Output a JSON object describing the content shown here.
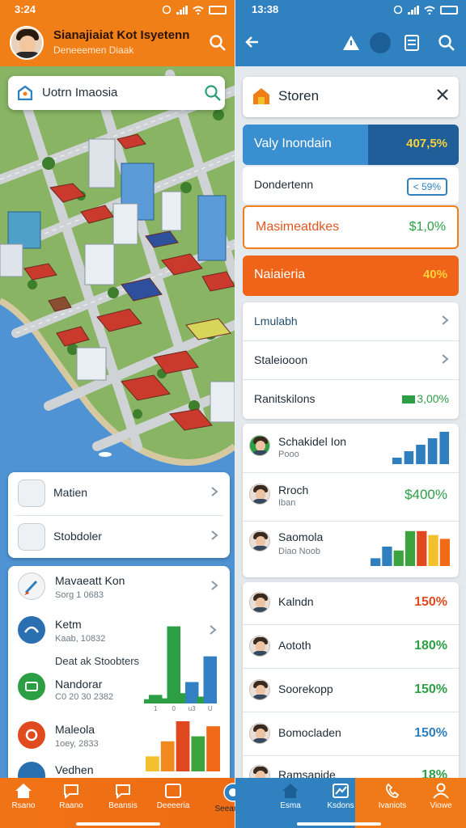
{
  "left": {
    "status": {
      "time": "3:24"
    },
    "header": {
      "title": "Sianajiaiat Kot Isyetenn",
      "subtitle": "Deneeemen Diaak"
    },
    "map_search": {
      "value": "Uotrn Imaosia"
    },
    "menu_top": [
      {
        "label": "Matien",
        "icon": "grid-icon"
      },
      {
        "label": "Stobdoler",
        "icon": "map-icon"
      }
    ],
    "people": [
      {
        "name": "Mavaeatt Kon",
        "sub": "Sorg 1 0683",
        "icon": "brush-icon",
        "color": "#f2f4f6",
        "has_chevron": true
      },
      {
        "name": "Ketm",
        "sub": "Kaab, 10832",
        "icon": "person-icon",
        "color": "#2a6fb0",
        "has_chevron": true
      },
      {
        "name": "Nandorar",
        "sub": "C0 20 30 2382",
        "icon": "leaf-icon",
        "color": "#2c9f45",
        "has_chevron": false
      },
      {
        "name": "Maleola",
        "sub": "1oey, 2833",
        "icon": "gear-icon",
        "color": "#e04a1f",
        "has_chevron": false
      },
      {
        "name": "Vedhen",
        "sub": "",
        "icon": "house-icon",
        "color": "#2a6fb0",
        "has_chevron": false
      }
    ],
    "section_label": "Deat ak Stoobters",
    "chart_data": [
      {
        "type": "bar",
        "categories": [
          "1",
          "0",
          "u3",
          "U"
        ],
        "series": [
          {
            "values": [
              1,
              9,
              2.5,
              5.5
            ]
          },
          {
            "values": [
              0.5,
              0.6,
              1.2,
              0.8
            ]
          }
        ],
        "ylim": [
          0,
          10
        ],
        "colors": [
          "#2c9f45",
          "#2c9f45",
          "#3380c4",
          "#3380c4"
        ]
      },
      {
        "type": "bar",
        "values": [
          3,
          6,
          10,
          7,
          9
        ],
        "ylim": [
          0,
          10
        ],
        "colors": [
          "#f2c12e",
          "#f08a1f",
          "#e0491f",
          "#3ca33f",
          "#f06a17"
        ]
      }
    ]
  },
  "right": {
    "status": {
      "time": "13:38"
    },
    "store": {
      "title": "Storen"
    },
    "highlight": {
      "label": "Valy Inondain",
      "value": "407,5%"
    },
    "rows": [
      {
        "label": "Dondertenn",
        "value": "< 59%",
        "style": "plain"
      },
      {
        "label": "Masimeatdkes",
        "value": "$1,0%",
        "style": "outlined"
      },
      {
        "label": "Naiaieria",
        "value": "40%",
        "style": "orange"
      }
    ],
    "menu": [
      {
        "label": "Lmulabh"
      },
      {
        "label": "Staleiooon"
      },
      {
        "label": "Ranitskilons",
        "value": "3,00%"
      }
    ],
    "stats": [
      {
        "name": "Schakidel Ion",
        "sub": "Pooo",
        "value": "",
        "color": "#2c9f45"
      },
      {
        "name": "Rroch",
        "sub": "Iban",
        "value": "$400%",
        "color": "#2c9f45"
      },
      {
        "name": "Saomola",
        "sub": "Diao Noob",
        "value": "",
        "color": "#2c9f45"
      }
    ],
    "leaders": [
      {
        "name": "Kalndn",
        "value": "150%",
        "color": "#e04a1f"
      },
      {
        "name": "Aototh",
        "value": "180%",
        "color": "#2c9f45"
      },
      {
        "name": "Soorekopp",
        "value": "150%",
        "color": "#2c9f45"
      },
      {
        "name": "Bomocladen",
        "value": "150%",
        "color": "#2f7fbf"
      },
      {
        "name": "Ramsapide",
        "value": "18%",
        "color": "#2c9f45"
      }
    ],
    "chart_data": [
      {
        "type": "bar",
        "values": [
          1,
          2,
          3,
          4,
          5
        ],
        "ylim": [
          0,
          5
        ],
        "colors": [
          "#2f7fbf",
          "#2f7fbf",
          "#2f7fbf",
          "#2f7fbf",
          "#2f7fbf"
        ]
      },
      {
        "type": "bar",
        "values": [
          2,
          5,
          4,
          9,
          9,
          8,
          7
        ],
        "ylim": [
          0,
          10
        ],
        "colors": [
          "#2f7fbf",
          "#2f7fbf",
          "#3ca33f",
          "#3ca33f",
          "#e0491f",
          "#f2c12e",
          "#f06a17"
        ]
      }
    ]
  },
  "nav": {
    "left": [
      "Rsano",
      "Raano",
      "Beansis",
      "Deeeeria",
      "Seeanens"
    ],
    "right": [
      "Esma",
      "Ksdons",
      "Ivaniots",
      "Viowe"
    ]
  },
  "colors": {
    "orange": "#f07f17",
    "blue": "#2f82bf",
    "green": "#2c9f45",
    "red": "#e04a1f"
  }
}
